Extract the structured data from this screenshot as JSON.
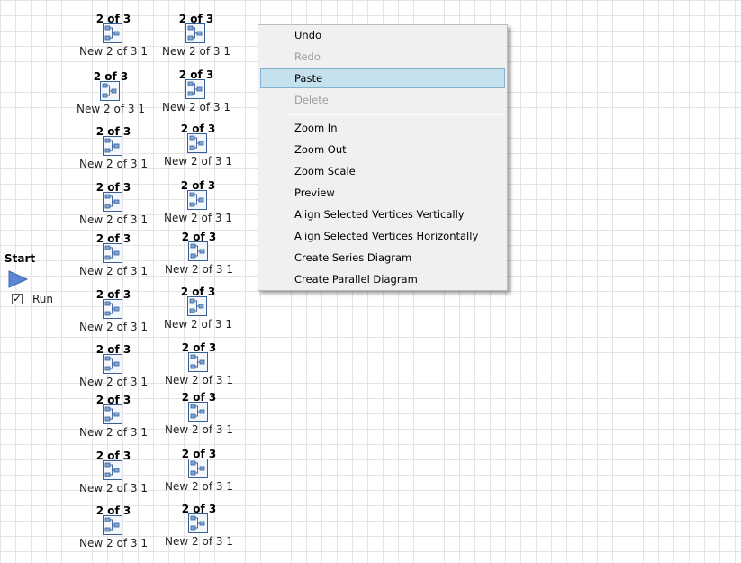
{
  "nodes": {
    "title": "2 of 3",
    "label": "New 2 of 3 1"
  },
  "start": {
    "title": "Start",
    "run_label": "Run",
    "run_checked": true,
    "check_glyph": "✓"
  },
  "context_menu": {
    "items": [
      {
        "label": "Undo",
        "enabled": true
      },
      {
        "label": "Redo",
        "enabled": false
      },
      {
        "label": "Paste",
        "enabled": true,
        "highlighted": true
      },
      {
        "label": "Delete",
        "enabled": false
      },
      {
        "label": "Zoom In",
        "enabled": true
      },
      {
        "label": "Zoom Out",
        "enabled": true
      },
      {
        "label": "Zoom Scale",
        "enabled": true
      },
      {
        "label": "Preview",
        "enabled": true
      },
      {
        "label": "Align Selected Vertices Vertically",
        "enabled": true
      },
      {
        "label": "Align Selected Vertices Horizontally",
        "enabled": true
      },
      {
        "label": "Create Series Diagram",
        "enabled": true
      },
      {
        "label": "Create Parallel Diagram",
        "enabled": true
      }
    ]
  },
  "colors": {
    "menu_highlight": "#c5e1ee",
    "start_arrow": "#5b86d6",
    "icon_border": "#3a5f94"
  },
  "icons": {
    "node": "flow-diagram-icon",
    "start": "play-arrow-icon"
  }
}
